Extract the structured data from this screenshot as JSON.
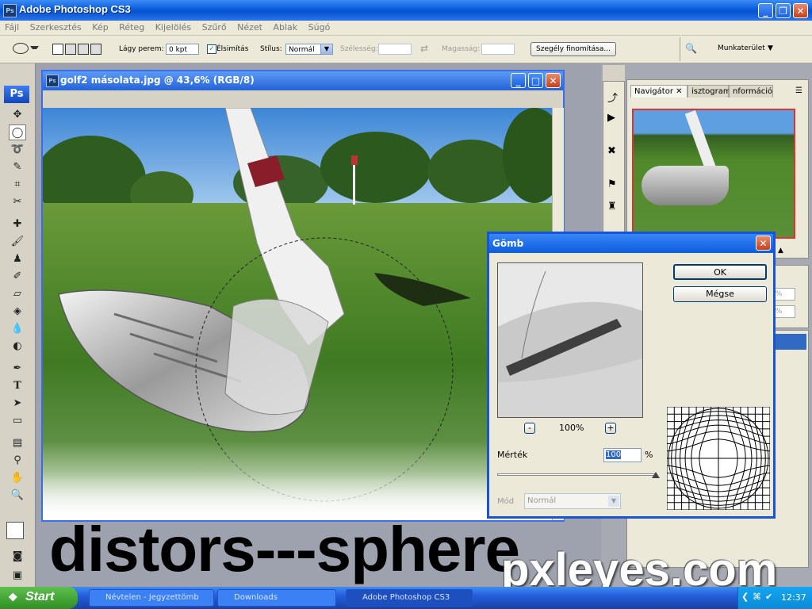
{
  "app": {
    "title": "Adobe Photoshop CS3",
    "logo": "Ps"
  },
  "menu": [
    "Fájl",
    "Szerkesztés",
    "Kép",
    "Réteg",
    "Kijelölés",
    "Szűrő",
    "Nézet",
    "Ablak",
    "Súgó"
  ],
  "options": {
    "feather_label": "Lágy perem:",
    "feather_value": "0 kpt",
    "antialias_label": "Élsimítás",
    "style_label": "Stílus:",
    "style_value": "Normál",
    "width_label": "Szélesség:",
    "height_label": "Magasság:",
    "refine_button": "Szegély finomítása...",
    "workspace_label": "Munkaterület"
  },
  "document": {
    "title": "golf2 másolata.jpg @ 43,6% (RGB/8)"
  },
  "panels": {
    "tabs": [
      "Navigátor",
      "isztogram",
      "nformáció"
    ],
    "zoom_values": [
      "0%",
      "0%"
    ]
  },
  "dialog": {
    "title": "Gömb",
    "ok": "OK",
    "cancel": "Mégse",
    "zoom": "100%",
    "minus": "-",
    "plus": "+",
    "amount_label": "Mérték",
    "amount_value": "100",
    "amount_unit": "%",
    "amount_fraction": 1.0,
    "mode_label": "Mód",
    "mode_value": "Normál"
  },
  "taskbar": {
    "start": "Start",
    "tasks": [
      "Névtelen - Jegyzettömb",
      "Downloads",
      "Adobe Photoshop CS3"
    ],
    "clock": "12:37"
  },
  "overlay": {
    "caption": "distors---sphere",
    "watermark": "pxleyes.com"
  },
  "colors": {
    "xp_blue": "#0a5ddf",
    "dialog_bg": "#ece9d8",
    "grass": "#4f8a2a",
    "sky": "#5d9fe0"
  }
}
